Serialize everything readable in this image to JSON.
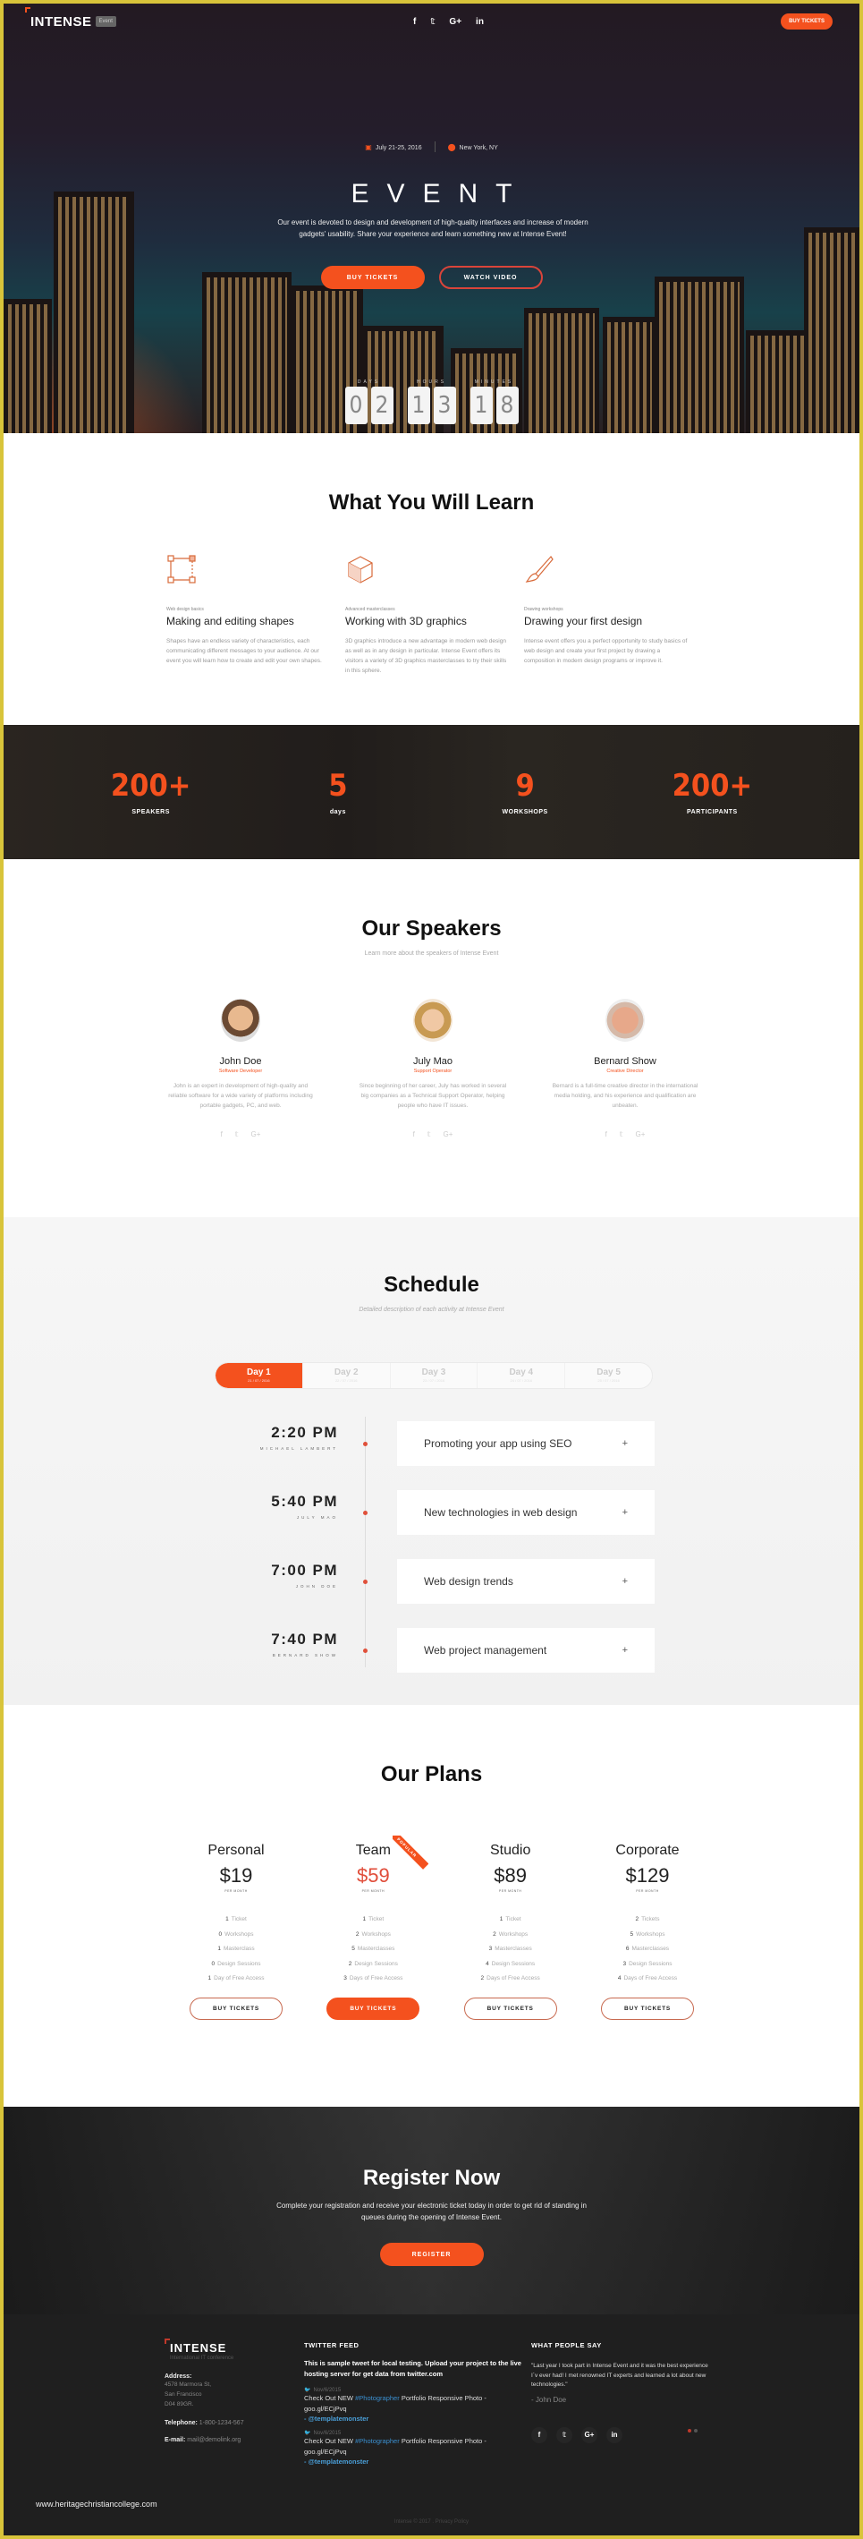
{
  "colors": {
    "accent": "#f4511e",
    "dark": "#1f1f1f",
    "link": "#3a8fd0"
  },
  "nav": {
    "logo": "INTENSE",
    "logo_badge": "Event",
    "social": [
      {
        "icon": "facebook-icon",
        "glyph": "f"
      },
      {
        "icon": "twitter-icon",
        "glyph": "𝕥"
      },
      {
        "icon": "google-plus-icon",
        "glyph": "G+"
      },
      {
        "icon": "linkedin-icon",
        "glyph": "in"
      }
    ],
    "cta": "BUY TICKETS"
  },
  "hero": {
    "date": "July 21-25, 2016",
    "location": "New York, NY",
    "title": "EVENT",
    "description": "Our event is devoted to design and development of high-quality interfaces and increase of modern gadgets' usability. Share your experience and learn something new at Intense Event!",
    "buy_label": "BUY TICKETS",
    "video_label": "WATCH VIDEO",
    "countdown": [
      {
        "label": "DAYS",
        "digits": [
          "0",
          "2"
        ]
      },
      {
        "label": "HOURS",
        "digits": [
          "1",
          "3"
        ]
      },
      {
        "label": "MINUTES",
        "digits": [
          "1",
          "8"
        ]
      }
    ]
  },
  "learn": {
    "title": "What You Will Learn",
    "items": [
      {
        "icon": "shapes-icon",
        "kicker": "Web design basics",
        "heading": "Making and editing shapes",
        "body": "Shapes have an endless variety of characteristics, each communicating different messages to your audience. At our event you will learn how to create and edit your own shapes."
      },
      {
        "icon": "cube-icon",
        "kicker": "Advanced masterclasses",
        "heading": "Working with 3D graphics",
        "body": "3D graphics introduce a new advantage in modern web design as well as in any design in particular. Intense Event offers its visitors a variety of 3D graphics masterclasses to try their skills in this sphere."
      },
      {
        "icon": "brush-icon",
        "kicker": "Drawing workshops",
        "heading": "Drawing your first design",
        "body": "Intense event offers you a perfect opportunity to study basics of web design and create your first project by drawing a composition in modern design programs or improve it."
      }
    ]
  },
  "stats": [
    {
      "value": "200+",
      "label": "SPEAKERS"
    },
    {
      "value": "5",
      "label": "days"
    },
    {
      "value": "9",
      "label": "WORKSHOPS"
    },
    {
      "value": "200+",
      "label": "PARTICIPANTS"
    }
  ],
  "speakers": {
    "title": "Our Speakers",
    "subtitle": "Learn more about the speakers of Intense Event",
    "items": [
      {
        "name": "John Doe",
        "role": "Software Developer",
        "bio": "John is an expert in development of high-quality and reliable software for a wide variety of platforms including portable gadgets, PC, and web."
      },
      {
        "name": "July Mao",
        "role": "Support Operator",
        "bio": "Since beginning of her career, July has worked in several big companies as a Technical Support Operator, helping people who have IT issues."
      },
      {
        "name": "Bernard Show",
        "role": "Creative Director",
        "bio": "Bernard is a full-time creative director in the international media holding, and his experience and qualification are unbeaten."
      }
    ],
    "social": [
      "f",
      "𝕥",
      "G+"
    ]
  },
  "schedule": {
    "title": "Schedule",
    "subtitle": "Detailed description of each activity at Intense Event",
    "days": [
      {
        "label": "Day 1",
        "date": "21 / 07 / 2016",
        "active": true
      },
      {
        "label": "Day 2",
        "date": "22 / 07 / 2016",
        "active": false
      },
      {
        "label": "Day 3",
        "date": "23 / 07 / 2016",
        "active": false
      },
      {
        "label": "Day 4",
        "date": "24 / 07 / 2016",
        "active": false
      },
      {
        "label": "Day 5",
        "date": "25 / 07 / 2016",
        "active": false
      }
    ],
    "events": [
      {
        "time": "2:20 PM",
        "speaker": "MICHAEL LAMBERT",
        "title": "Promoting your app using SEO"
      },
      {
        "time": "5:40 PM",
        "speaker": "JULY MAO",
        "title": "New technologies in web design"
      },
      {
        "time": "7:00 PM",
        "speaker": "JOHN DOE",
        "title": "Web design trends"
      },
      {
        "time": "7:40 PM",
        "speaker": "BERNARD SHOW",
        "title": "Web project management"
      }
    ],
    "expand_glyph": "+"
  },
  "plans": {
    "title": "Our Plans",
    "per": "PER MONTH",
    "popular_badge": "POPULAR",
    "button_label": "BUY TICKETS",
    "items": [
      {
        "name": "Personal",
        "price": "$19",
        "popular": false,
        "features": [
          [
            "1",
            "Ticket"
          ],
          [
            "0",
            "Workshops"
          ],
          [
            "1",
            "Masterclass"
          ],
          [
            "0",
            "Design Sessions"
          ],
          [
            "1",
            "Day of Free Access"
          ]
        ]
      },
      {
        "name": "Team",
        "price": "$59",
        "popular": true,
        "features": [
          [
            "1",
            "Ticket"
          ],
          [
            "2",
            "Workshops"
          ],
          [
            "5",
            "Masterclasses"
          ],
          [
            "2",
            "Design Sessions"
          ],
          [
            "3",
            "Days of Free Access"
          ]
        ]
      },
      {
        "name": "Studio",
        "price": "$89",
        "popular": false,
        "features": [
          [
            "1",
            "Ticket"
          ],
          [
            "2",
            "Workshops"
          ],
          [
            "3",
            "Masterclasses"
          ],
          [
            "4",
            "Design Sessions"
          ],
          [
            "2",
            "Days of Free Access"
          ]
        ]
      },
      {
        "name": "Corporate",
        "price": "$129",
        "popular": false,
        "features": [
          [
            "2",
            "Tickets"
          ],
          [
            "5",
            "Workshops"
          ],
          [
            "6",
            "Masterclasses"
          ],
          [
            "3",
            "Design Sessions"
          ],
          [
            "4",
            "Days of Free Access"
          ]
        ]
      }
    ]
  },
  "register": {
    "title": "Register Now",
    "description": "Complete your registration and receive your electronic ticket today in order to get rid of standing in queues during the opening of Intense Event.",
    "button": "REGISTER"
  },
  "footer": {
    "logo": "INTENSE",
    "tagline": "International IT conference",
    "address_label": "Address:",
    "address_lines": [
      "4578 Marmora St,",
      "San Francisco",
      "D04 89GR."
    ],
    "phone_label": "Telephone:",
    "phone": "1-800-1234-567",
    "email_label": "E-mail:",
    "email": "mail@demolink.org",
    "twitter": {
      "heading": "TWITTER FEED",
      "lead": "This is sample tweet for local testing. Upload your project to the live hosting server for get data from twitter.com",
      "tweets": [
        {
          "date": "Nov/6/2015",
          "prefix": "Check Out NEW ",
          "hashtag": "#Photographer",
          "suffix": " Portfolio Responsive Photo - goo.gl/ECjPvq",
          "handle": "- @templatemonster"
        },
        {
          "date": "Nov/6/2015",
          "prefix": "Check Out NEW ",
          "hashtag": "#Photographer",
          "suffix": " Portfolio Responsive Photo - goo.gl/ECjPvq",
          "handle": "- @templatemonster"
        }
      ]
    },
    "testimonials": {
      "heading": "WHAT PEOPLE SAY",
      "quote": "\"Last year I took part in Intense Event and it was the best experience I`v ever had! I met renowned IT experts and learned a lot about new technologies.\"",
      "author": "- John Doe"
    },
    "social": [
      "f",
      "𝕥",
      "G+",
      "in"
    ],
    "copyright": "Intense © 2017 . Privacy Policy"
  },
  "watermark": "www.heritagechristiancollege.com"
}
